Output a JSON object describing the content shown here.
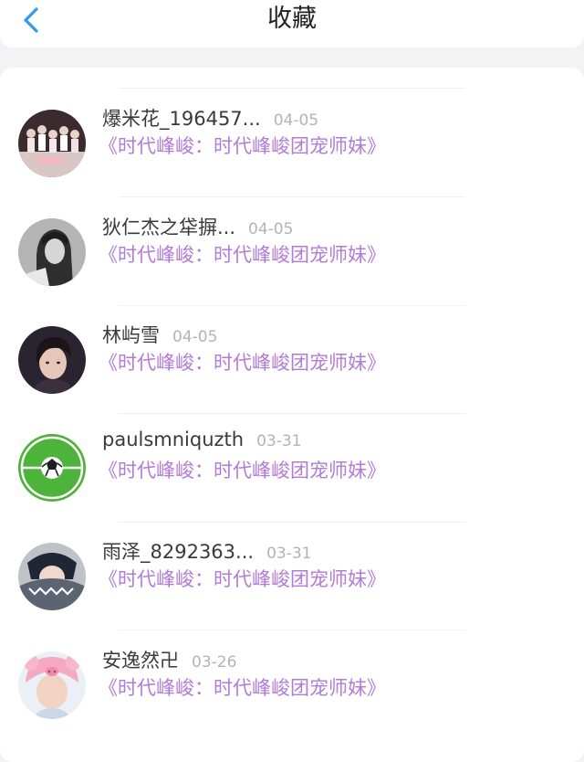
{
  "header": {
    "title": "收藏",
    "back_icon": "chevron-left-icon",
    "accent_color": "#2d9cf0"
  },
  "favorites": [
    {
      "user": "爆米花_196457...",
      "date": "04-05",
      "title": "《时代峰峻：时代峰峻团宠师妹》",
      "avatar": "group-photo-avatar"
    },
    {
      "user": "狄仁杰之牮摒...",
      "date": "04-05",
      "title": "《时代峰峻：时代峰峻团宠师妹》",
      "avatar": "grayscale-portrait-avatar"
    },
    {
      "user": "林屿雪",
      "date": "04-05",
      "title": "《时代峰峻：时代峰峻团宠师妹》",
      "avatar": "portrait-avatar"
    },
    {
      "user": "paulsmniquzth",
      "date": "03-31",
      "title": "《时代峰峻：时代峰峻团宠师妹》",
      "avatar": "soccer-ball-avatar"
    },
    {
      "user": "雨泽_8292363...",
      "date": "03-31",
      "title": "《时代峰峻：时代峰峻团宠师妹》",
      "avatar": "shark-hood-avatar"
    },
    {
      "user": "安逸然卍",
      "date": "03-26",
      "title": "《时代峰峻：时代峰峻团宠师妹》",
      "avatar": "pig-hat-avatar"
    }
  ],
  "colors": {
    "title_link": "#b27bd8",
    "date": "#b3b3b3",
    "username": "#3a3a3a",
    "background": "#f3f3f5"
  }
}
